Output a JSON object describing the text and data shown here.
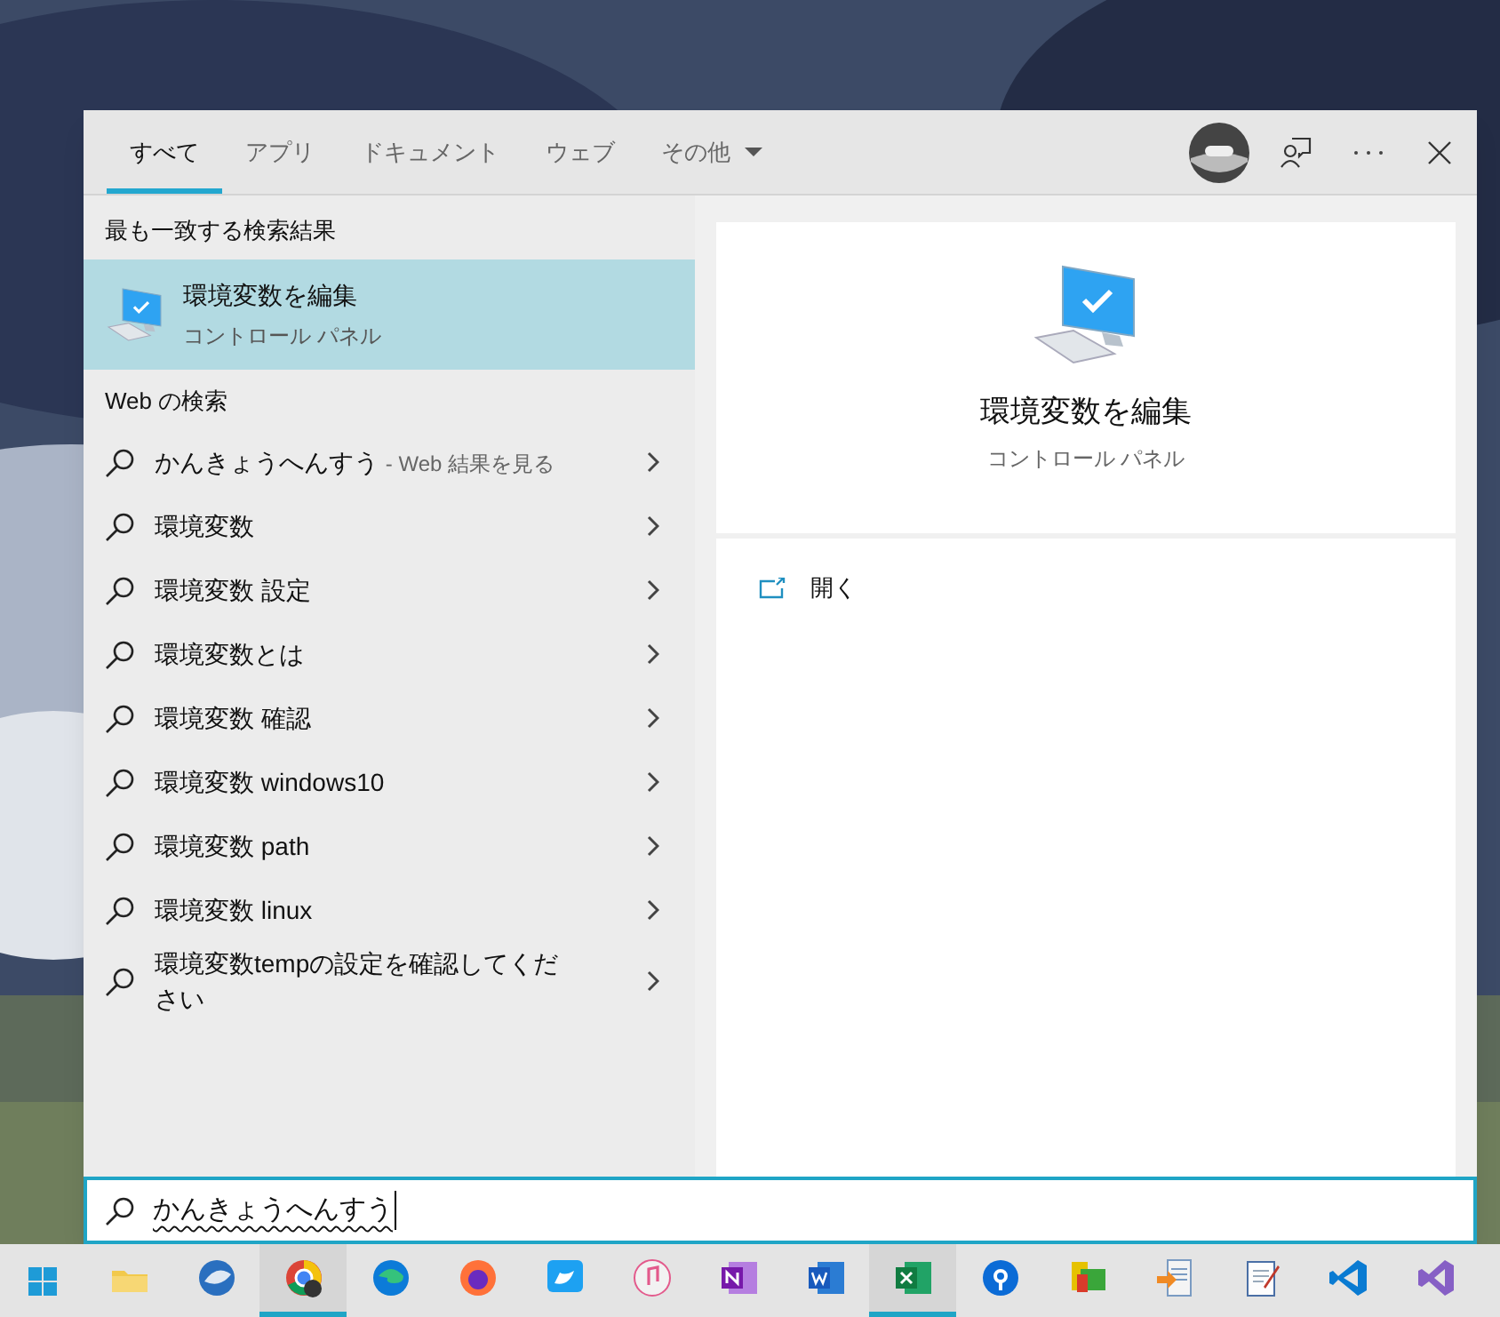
{
  "tabs": [
    {
      "label": "すべて",
      "selected": true,
      "kind": "tab"
    },
    {
      "label": "アプリ",
      "selected": false,
      "kind": "tab"
    },
    {
      "label": "ドキュメント",
      "selected": false,
      "kind": "tab"
    },
    {
      "label": "ウェブ",
      "selected": false,
      "kind": "tab"
    },
    {
      "label": "その他",
      "selected": false,
      "kind": "menu"
    }
  ],
  "best_match": {
    "heading": "最も一致する検索結果",
    "title": "環境変数を編集",
    "subtitle": "コントロール パネル",
    "selected": true
  },
  "web_search": {
    "heading": "Web の検索",
    "items": [
      {
        "text": "かんきょうへんすう",
        "hint": "- Web 結果を見る"
      },
      {
        "text": "環境変数"
      },
      {
        "text": "環境変数 設定"
      },
      {
        "text": "環境変数とは"
      },
      {
        "text": "環境変数 確認"
      },
      {
        "text": "環境変数 windows10"
      },
      {
        "text": "環境変数 path"
      },
      {
        "text": "環境変数 linux"
      },
      {
        "text": "環境変数tempの設定を確認してください"
      }
    ]
  },
  "preview": {
    "title": "環境変数を編集",
    "subtitle": "コントロール パネル",
    "actions": [
      {
        "label": "開く"
      }
    ]
  },
  "search": {
    "value": "かんきょうへんすう"
  },
  "taskbar": [
    {
      "running": false
    },
    {
      "running": false
    },
    {
      "running": true
    },
    {
      "running": false
    },
    {
      "running": false
    },
    {
      "running": false
    },
    {
      "running": false
    },
    {
      "running": false
    },
    {
      "running": false
    },
    {
      "running": true
    },
    {
      "running": false
    },
    {
      "running": false
    },
    {
      "running": false
    },
    {
      "running": false
    },
    {
      "running": false
    },
    {
      "running": false
    }
  ]
}
